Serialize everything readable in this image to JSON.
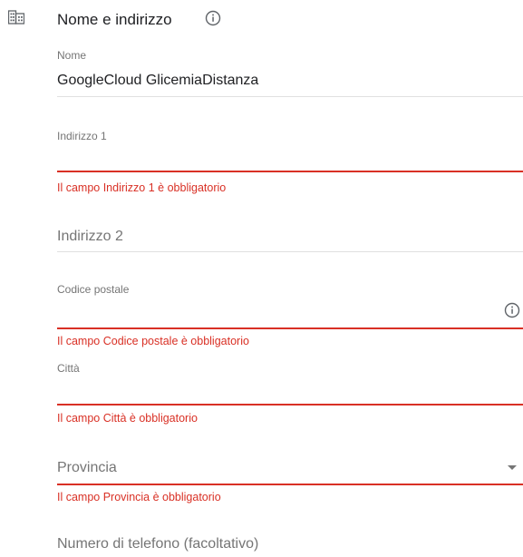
{
  "section": {
    "title": "Nome e indirizzo",
    "icon": "building-icon",
    "info_icon": "info-icon"
  },
  "fields": {
    "nome": {
      "label": "Nome",
      "value": "GoogleCloud GlicemiaDistanza"
    },
    "indirizzo1": {
      "label": "Indirizzo 1",
      "value": "",
      "error": "Il campo Indirizzo 1 è obbligatorio"
    },
    "indirizzo2": {
      "label": "Indirizzo 2",
      "value": ""
    },
    "codice_postale": {
      "label": "Codice postale",
      "value": "",
      "error": "Il campo Codice postale è obbligatorio",
      "info_icon": "info-icon"
    },
    "citta": {
      "label": "Città",
      "value": "",
      "error": "Il campo Città è obbligatorio"
    },
    "provincia": {
      "label": "Provincia",
      "value": "",
      "error": "Il campo Provincia è obbligatorio",
      "dropdown_icon": "dropdown-arrow-icon"
    },
    "telefono": {
      "label": "Numero di telefono (facoltativo)",
      "value": ""
    }
  },
  "colors": {
    "error": "#d93025",
    "label": "#757575",
    "text": "#202124",
    "divider": "#e0e0e0"
  }
}
